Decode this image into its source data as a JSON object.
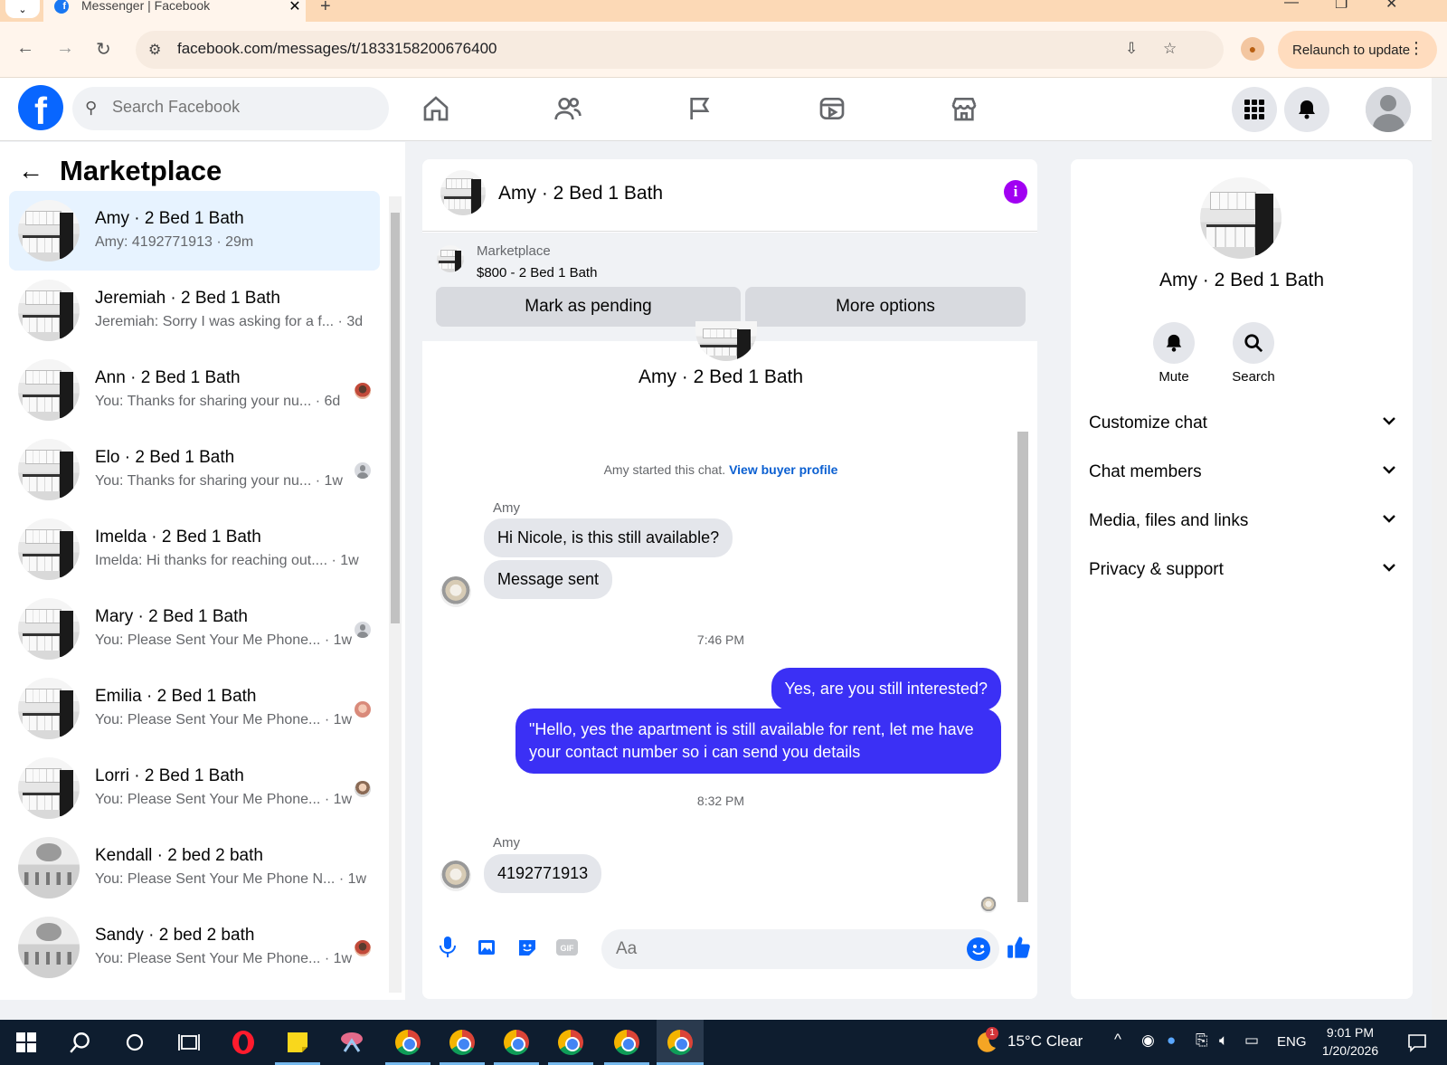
{
  "browser": {
    "tab_title": "Messenger | Facebook",
    "url": "facebook.com/messages/t/1833158200676400",
    "relaunch_label": "Relaunch to update"
  },
  "fb": {
    "search_placeholder": "Search Facebook"
  },
  "sidebar": {
    "title": "Marketplace",
    "conversations": [
      {
        "name": "Amy · 2 Bed 1 Bath",
        "snippet": "Amy: 4192771913 · 29m",
        "thumb": "kitchen",
        "mini": "",
        "active": true
      },
      {
        "name": "Jeremiah · 2 Bed 1 Bath",
        "snippet": "Jeremiah: Sorry I was asking for a f... · 3d",
        "thumb": "kitchen",
        "mini": ""
      },
      {
        "name": "Ann · 2 Bed 1 Bath",
        "snippet": "You: Thanks for sharing your nu... · 6d",
        "thumb": "kitchen",
        "mini": "person2"
      },
      {
        "name": "Elo · 2 Bed 1 Bath",
        "snippet": "You: Thanks for sharing your nu... · 1w",
        "thumb": "kitchen",
        "mini": "silhouette"
      },
      {
        "name": "Imelda · 2 Bed 1 Bath",
        "snippet": "Imelda: Hi thanks for reaching out.... · 1w",
        "thumb": "kitchen",
        "mini": ""
      },
      {
        "name": "Mary · 2 Bed 1 Bath",
        "snippet": "You: Please Sent Your Me Phone... · 1w",
        "thumb": "kitchen",
        "mini": "silhouette"
      },
      {
        "name": "Emilia · 2 Bed 1 Bath",
        "snippet": "You: Please Sent Your Me Phone... · 1w",
        "thumb": "kitchen",
        "mini": "person3"
      },
      {
        "name": "Lorri · 2 Bed 1 Bath",
        "snippet": "You: Please Sent Your Me Phone... · 1w",
        "thumb": "kitchen",
        "mini": "person"
      },
      {
        "name": "Kendall · 2 bed 2 bath",
        "snippet": "You: Please Sent Your Me Phone N... · 1w",
        "thumb": "kitchen2",
        "mini": ""
      },
      {
        "name": "Sandy · 2 bed 2 bath",
        "snippet": "You: Please Sent Your Me Phone... · 1w",
        "thumb": "kitchen2",
        "mini": "person2"
      }
    ]
  },
  "chat": {
    "title": "Amy · 2 Bed 1 Bath",
    "listing_category": "Marketplace",
    "listing_price": "$800 - 2 Bed 1 Bath",
    "mark_pending": "Mark as pending",
    "more_options": "More options",
    "intro_name": "Amy · 2 Bed 1 Bath",
    "started_note": "Amy started this chat.",
    "buyer_profile_link": "View buyer profile",
    "sender1": "Amy",
    "msg1": "Hi Nicole, is this still available?",
    "msg2": "Message sent",
    "time1": "7:46 PM",
    "out1": "Yes, are you still interested?",
    "out2": "\"Hello, yes the apartment is still available for rent, let me have your contact number so i can send you details",
    "time2": "8:32 PM",
    "sender2": "Amy",
    "msg3": "4192771913",
    "composer_placeholder": "Aa"
  },
  "details": {
    "name": "Amy · 2 Bed 1 Bath",
    "mute": "Mute",
    "search": "Search",
    "sections": [
      "Customize chat",
      "Chat members",
      "Media, files and links",
      "Privacy & support"
    ]
  },
  "taskbar": {
    "weather": "15°C  Clear",
    "weather_badge": "1",
    "lang": "ENG",
    "time": "9:01 PM",
    "date": "1/20/2026"
  },
  "colors": {
    "fb_blue": "#0866ff",
    "outgoing_bubble": "#3b30f5",
    "info_purple": "#a100f2",
    "active_row": "#e7f3ff"
  }
}
